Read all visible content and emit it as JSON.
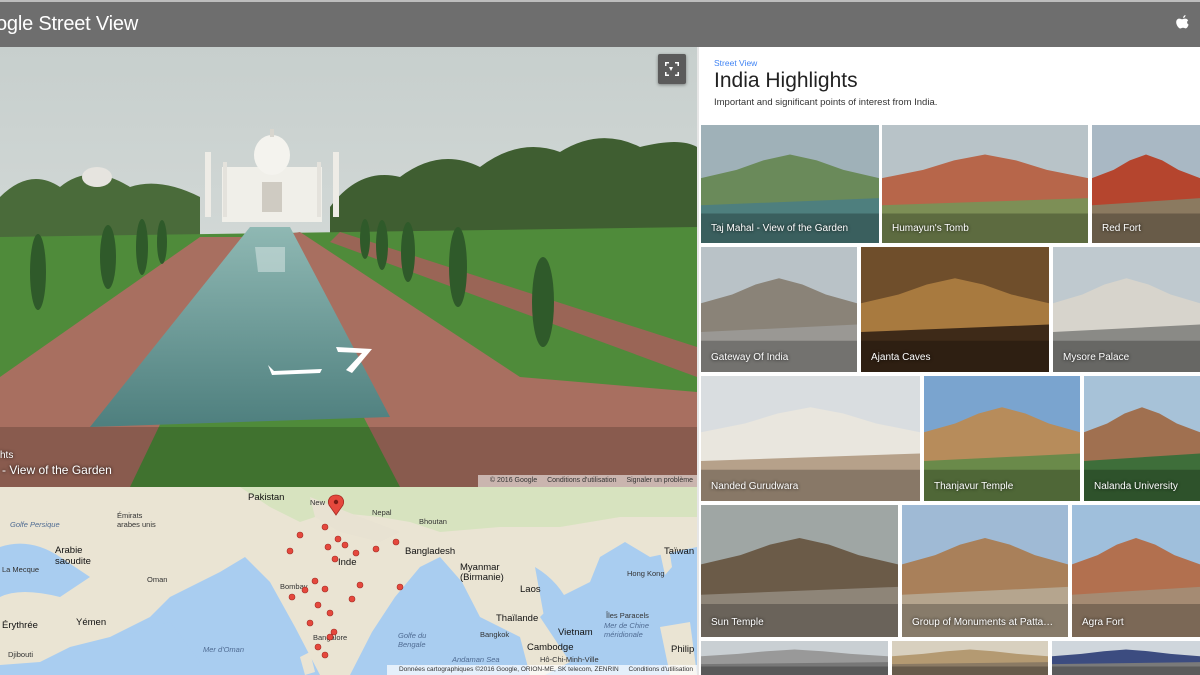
{
  "header": {
    "brand": "ogle Street View",
    "apple_icon": "apple-icon"
  },
  "pano": {
    "caption_line1": "hts",
    "caption_line2": "- View of the Garden",
    "footer": {
      "copyright": "© 2016 Google",
      "terms": "Conditions d'utilisation",
      "report": "Signaler un problème"
    },
    "expand_icon": "expand-icon"
  },
  "map": {
    "labels": {
      "pakistan": "Pakistan",
      "new_delhi": "New",
      "nepal": "Nepal",
      "bhoutan": "Bhoutan",
      "golfe_persique": "Golfe Persique",
      "emirats": "Émirats\narabes unis",
      "bangladesh": "Bangladesh",
      "taiwan": "Taïwan",
      "arabie": "Arabie\nsaoudite",
      "inde": "Inde",
      "oman": "Oman",
      "myanmar": "Myanmar\n(Birmanie)",
      "hong_kong": "Hong Kong",
      "laos": "Laos",
      "bombay": "Bombay",
      "yemen": "Yémen",
      "thailande": "Thaïlande",
      "bangalore": "Bangalore",
      "golfe_bengale": "Golfe du\nBengale",
      "paracels": "Îles Paracels",
      "mer_chine": "Mer de Chine\nméridionale",
      "bangkok": "Bangkok",
      "vietnam": "Vietnam",
      "erythree": "Érythrée",
      "djibouti": "Djibouti",
      "mer_oman": "Mer d'Oman",
      "cambodge": "Cambodge",
      "philip": "Philip",
      "andaman": "Andaman Sea",
      "ho_chi": "Hô-Chi-Minh-Ville",
      "mecque": "La Mecque"
    },
    "footer": {
      "data": "Données cartographiques ©2016 Google, ORION-ME, SK telecom, ZENRIN",
      "terms": "Conditions d'utilisation"
    }
  },
  "panel": {
    "crumb": "Street View",
    "title": "India Highlights",
    "subtitle": "Important and significant points of interest from India.",
    "tiles": [
      "Taj Mahal - View of the Garden",
      "Humayun's Tomb",
      "Red Fort",
      "Gateway Of India",
      "Ajanta Caves",
      "Mysore Palace",
      "Nanded Gurudwara",
      "Thanjavur Temple",
      "Nalanda University",
      "Sun Temple",
      "Group of Monuments at Patta…",
      "Agra Fort"
    ]
  },
  "colors": {
    "accent": "#4d90fe",
    "topbar": "#6e6e6e",
    "marker": "#e5483d",
    "link": "#4285f4"
  }
}
